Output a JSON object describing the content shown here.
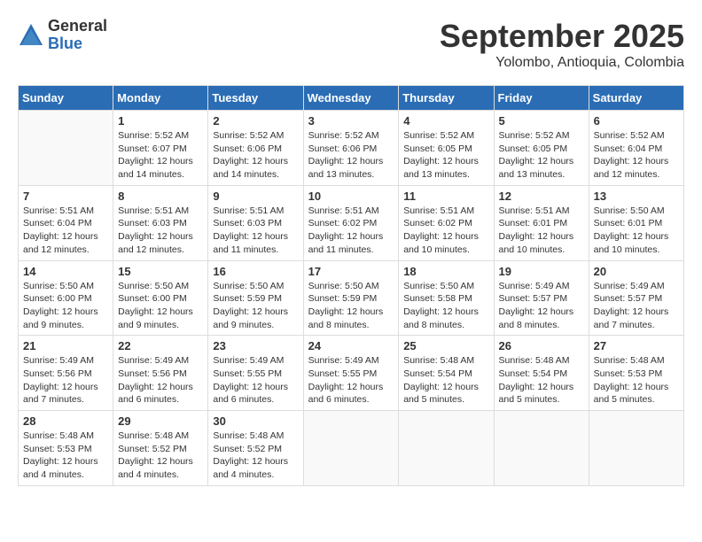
{
  "logo": {
    "general": "General",
    "blue": "Blue"
  },
  "header": {
    "month": "September 2025",
    "location": "Yolombo, Antioquia, Colombia"
  },
  "weekdays": [
    "Sunday",
    "Monday",
    "Tuesday",
    "Wednesday",
    "Thursday",
    "Friday",
    "Saturday"
  ],
  "weeks": [
    [
      {
        "day": "",
        "info": ""
      },
      {
        "day": "1",
        "info": "Sunrise: 5:52 AM\nSunset: 6:07 PM\nDaylight: 12 hours\nand 14 minutes."
      },
      {
        "day": "2",
        "info": "Sunrise: 5:52 AM\nSunset: 6:06 PM\nDaylight: 12 hours\nand 14 minutes."
      },
      {
        "day": "3",
        "info": "Sunrise: 5:52 AM\nSunset: 6:06 PM\nDaylight: 12 hours\nand 13 minutes."
      },
      {
        "day": "4",
        "info": "Sunrise: 5:52 AM\nSunset: 6:05 PM\nDaylight: 12 hours\nand 13 minutes."
      },
      {
        "day": "5",
        "info": "Sunrise: 5:52 AM\nSunset: 6:05 PM\nDaylight: 12 hours\nand 13 minutes."
      },
      {
        "day": "6",
        "info": "Sunrise: 5:52 AM\nSunset: 6:04 PM\nDaylight: 12 hours\nand 12 minutes."
      }
    ],
    [
      {
        "day": "7",
        "info": "Sunrise: 5:51 AM\nSunset: 6:04 PM\nDaylight: 12 hours\nand 12 minutes."
      },
      {
        "day": "8",
        "info": "Sunrise: 5:51 AM\nSunset: 6:03 PM\nDaylight: 12 hours\nand 12 minutes."
      },
      {
        "day": "9",
        "info": "Sunrise: 5:51 AM\nSunset: 6:03 PM\nDaylight: 12 hours\nand 11 minutes."
      },
      {
        "day": "10",
        "info": "Sunrise: 5:51 AM\nSunset: 6:02 PM\nDaylight: 12 hours\nand 11 minutes."
      },
      {
        "day": "11",
        "info": "Sunrise: 5:51 AM\nSunset: 6:02 PM\nDaylight: 12 hours\nand 10 minutes."
      },
      {
        "day": "12",
        "info": "Sunrise: 5:51 AM\nSunset: 6:01 PM\nDaylight: 12 hours\nand 10 minutes."
      },
      {
        "day": "13",
        "info": "Sunrise: 5:50 AM\nSunset: 6:01 PM\nDaylight: 12 hours\nand 10 minutes."
      }
    ],
    [
      {
        "day": "14",
        "info": "Sunrise: 5:50 AM\nSunset: 6:00 PM\nDaylight: 12 hours\nand 9 minutes."
      },
      {
        "day": "15",
        "info": "Sunrise: 5:50 AM\nSunset: 6:00 PM\nDaylight: 12 hours\nand 9 minutes."
      },
      {
        "day": "16",
        "info": "Sunrise: 5:50 AM\nSunset: 5:59 PM\nDaylight: 12 hours\nand 9 minutes."
      },
      {
        "day": "17",
        "info": "Sunrise: 5:50 AM\nSunset: 5:59 PM\nDaylight: 12 hours\nand 8 minutes."
      },
      {
        "day": "18",
        "info": "Sunrise: 5:50 AM\nSunset: 5:58 PM\nDaylight: 12 hours\nand 8 minutes."
      },
      {
        "day": "19",
        "info": "Sunrise: 5:49 AM\nSunset: 5:57 PM\nDaylight: 12 hours\nand 8 minutes."
      },
      {
        "day": "20",
        "info": "Sunrise: 5:49 AM\nSunset: 5:57 PM\nDaylight: 12 hours\nand 7 minutes."
      }
    ],
    [
      {
        "day": "21",
        "info": "Sunrise: 5:49 AM\nSunset: 5:56 PM\nDaylight: 12 hours\nand 7 minutes."
      },
      {
        "day": "22",
        "info": "Sunrise: 5:49 AM\nSunset: 5:56 PM\nDaylight: 12 hours\nand 6 minutes."
      },
      {
        "day": "23",
        "info": "Sunrise: 5:49 AM\nSunset: 5:55 PM\nDaylight: 12 hours\nand 6 minutes."
      },
      {
        "day": "24",
        "info": "Sunrise: 5:49 AM\nSunset: 5:55 PM\nDaylight: 12 hours\nand 6 minutes."
      },
      {
        "day": "25",
        "info": "Sunrise: 5:48 AM\nSunset: 5:54 PM\nDaylight: 12 hours\nand 5 minutes."
      },
      {
        "day": "26",
        "info": "Sunrise: 5:48 AM\nSunset: 5:54 PM\nDaylight: 12 hours\nand 5 minutes."
      },
      {
        "day": "27",
        "info": "Sunrise: 5:48 AM\nSunset: 5:53 PM\nDaylight: 12 hours\nand 5 minutes."
      }
    ],
    [
      {
        "day": "28",
        "info": "Sunrise: 5:48 AM\nSunset: 5:53 PM\nDaylight: 12 hours\nand 4 minutes."
      },
      {
        "day": "29",
        "info": "Sunrise: 5:48 AM\nSunset: 5:52 PM\nDaylight: 12 hours\nand 4 minutes."
      },
      {
        "day": "30",
        "info": "Sunrise: 5:48 AM\nSunset: 5:52 PM\nDaylight: 12 hours\nand 4 minutes."
      },
      {
        "day": "",
        "info": ""
      },
      {
        "day": "",
        "info": ""
      },
      {
        "day": "",
        "info": ""
      },
      {
        "day": "",
        "info": ""
      }
    ]
  ]
}
